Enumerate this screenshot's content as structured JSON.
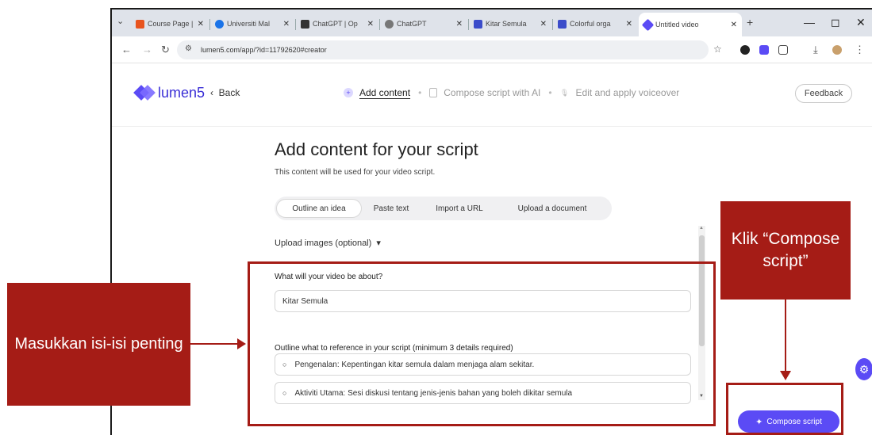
{
  "browser": {
    "tabs": [
      {
        "label": "Course Page |",
        "color": "#e8541e"
      },
      {
        "label": "Universiti Mal",
        "color": "#1a73e8"
      },
      {
        "label": "ChatGPT | Op",
        "color": "#333333"
      },
      {
        "label": "ChatGPT",
        "color": "#555555"
      },
      {
        "label": "Kitar Semula",
        "color": "#3b4cca"
      },
      {
        "label": "Colorful orga",
        "color": "#3b4cca"
      },
      {
        "label": "Untitled video",
        "color": "#5b4bf5"
      }
    ],
    "url": "lumen5.com/app/?id=11792620#creator"
  },
  "app": {
    "logo_text": "lumen5",
    "back_label": "Back",
    "steps": [
      {
        "label": "Add content",
        "icon": "plus-icon",
        "active": true
      },
      {
        "label": "Compose script with AI",
        "icon": "document-icon",
        "active": false
      },
      {
        "label": "Edit and apply voiceover",
        "icon": "mic-icon",
        "active": false
      }
    ],
    "feedback_label": "Feedback"
  },
  "main": {
    "title": "Add content for your script",
    "subtitle": "This content will be used for your video script.",
    "input_tabs": [
      "Outline an idea",
      "Paste text",
      "Import a URL",
      "Upload a document"
    ],
    "selected_tab": "Outline an idea",
    "upload_images_label": "Upload images (optional)",
    "question_about": "What will your video be about?",
    "about_value": "Kitar Semula",
    "question_outline": "Outline what to reference in your script (minimum 3 details required)",
    "outline_items": [
      "Pengenalan:  Kepentingan kitar semula dalam menjaga alam sekitar.",
      "Aktiviti Utama: Sesi diskusi tentang jenis-jenis bahan yang boleh dikitar semula"
    ],
    "compose_button": "Compose script"
  },
  "annotations": {
    "left_callout": "Masukkan isi-isi penting",
    "right_callout": "Klik “Compose script”",
    "accent": "#a51c16"
  }
}
